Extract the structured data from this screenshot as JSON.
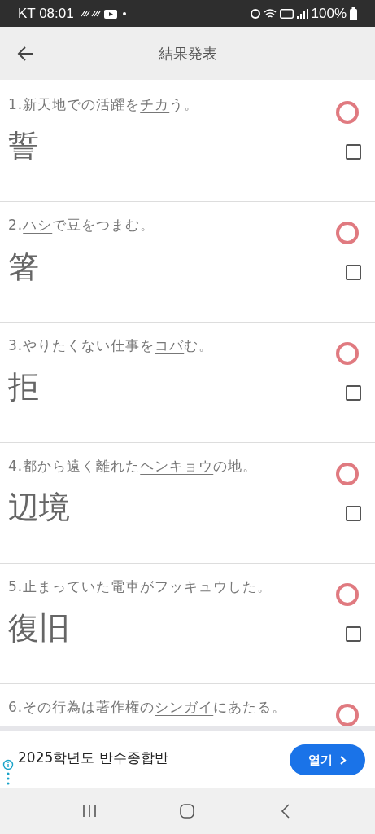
{
  "status_bar": {
    "carrier_time": "KT 08:01",
    "battery": "100%"
  },
  "app_bar": {
    "title": "結果発表"
  },
  "questions": [
    {
      "number": "1.",
      "before": "新天地での活躍を",
      "underlined": "チカ",
      "after": "う。",
      "answer": "誓",
      "correct": true,
      "checked": false
    },
    {
      "number": "2.",
      "underlined": "ハシ",
      "after": "で豆をつまむ。",
      "answer": "箸",
      "correct": true,
      "checked": false
    },
    {
      "number": "3.",
      "before": "やりたくない仕事を",
      "underlined": "コバ",
      "after": "む。",
      "answer": "拒",
      "correct": true,
      "checked": false
    },
    {
      "number": "4.",
      "before": "都から遠く離れた",
      "underlined": "ヘンキョウ",
      "after": "の地。",
      "answer": "辺境",
      "correct": true,
      "checked": false
    },
    {
      "number": "5.",
      "before": "止まっていた電車が",
      "underlined": "フッキュウ",
      "after": "した。",
      "answer": "復旧",
      "correct": true,
      "checked": false
    },
    {
      "number": "6.",
      "before": "その行為は著作権の",
      "underlined": "シンガイ",
      "after": "にあたる。",
      "correct": true
    }
  ],
  "ad": {
    "text": "2025학년도 반수종합반",
    "button": "열기"
  }
}
